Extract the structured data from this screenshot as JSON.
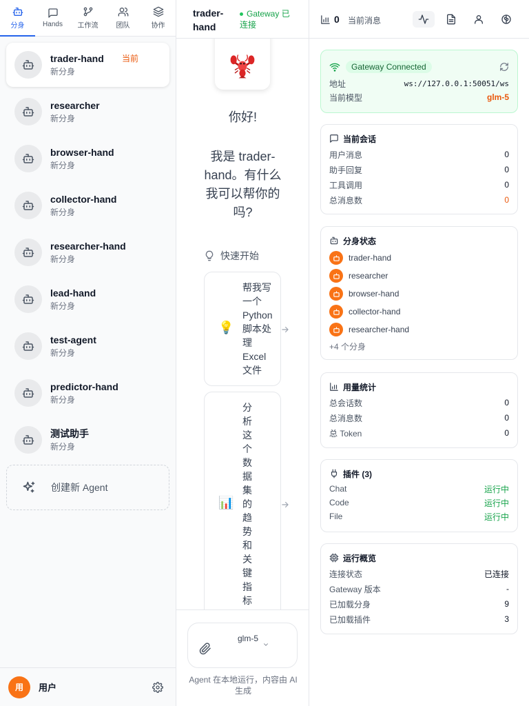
{
  "nav_tabs": [
    {
      "label": "分身",
      "icon": "bot-icon"
    },
    {
      "label": "Hands",
      "icon": "chat-icon"
    },
    {
      "label": "工作流",
      "icon": "workflow-icon"
    },
    {
      "label": "团队",
      "icon": "team-icon"
    },
    {
      "label": "协作",
      "icon": "layers-icon"
    }
  ],
  "agents": [
    {
      "name": "trader-hand",
      "sub": "新分身",
      "badge": "当前"
    },
    {
      "name": "researcher",
      "sub": "新分身"
    },
    {
      "name": "browser-hand",
      "sub": "新分身"
    },
    {
      "name": "collector-hand",
      "sub": "新分身"
    },
    {
      "name": "researcher-hand",
      "sub": "新分身"
    },
    {
      "name": "lead-hand",
      "sub": "新分身"
    },
    {
      "name": "test-agent",
      "sub": "新分身"
    },
    {
      "name": "predictor-hand",
      "sub": "新分身"
    },
    {
      "name": "测试助手",
      "sub": "新分身"
    }
  ],
  "create_agent_label": "创建新 Agent",
  "user": {
    "avatar_text": "用",
    "name": "用户"
  },
  "chat": {
    "title": "trader-hand",
    "status": "Gateway 已连接",
    "greeting": "你好!",
    "intro": "我是 trader-hand。有什么我可以帮你的吗?",
    "quick_start_label": "快速开始",
    "suggestions": [
      {
        "emoji": "💡",
        "text": "帮我写一个Python脚本处理Excel文件"
      },
      {
        "emoji": "📊",
        "text": "分析这个数据集的趋势和关键指标"
      }
    ],
    "model": "glm-5",
    "footnote": "Agent 在本地运行，内容由 AI 生成"
  },
  "right_header": {
    "count": "0",
    "label": "当前消息"
  },
  "gateway": {
    "badge": "Gateway Connected",
    "address_label": "地址",
    "address": "ws://127.0.0.1:50051/ws",
    "model_label": "当前模型",
    "model": "glm-5"
  },
  "session": {
    "title": "当前会话",
    "rows": [
      {
        "label": "用户消息",
        "value": "0"
      },
      {
        "label": "助手回复",
        "value": "0"
      },
      {
        "label": "工具调用",
        "value": "0"
      },
      {
        "label": "总消息数",
        "value": "0"
      }
    ]
  },
  "hand_status": {
    "title": "分身状态",
    "items": [
      "trader-hand",
      "researcher",
      "browser-hand",
      "collector-hand",
      "researcher-hand"
    ],
    "more": "+4 个分身"
  },
  "usage": {
    "title": "用量统计",
    "rows": [
      {
        "label": "总会话数",
        "value": "0"
      },
      {
        "label": "总消息数",
        "value": "0"
      },
      {
        "label": "总 Token",
        "value": "0"
      }
    ]
  },
  "plugins": {
    "title": "插件 (3)",
    "rows": [
      {
        "label": "Chat",
        "value": "运行中"
      },
      {
        "label": "Code",
        "value": "运行中"
      },
      {
        "label": "File",
        "value": "运行中"
      }
    ]
  },
  "overview": {
    "title": "运行概览",
    "rows": [
      {
        "label": "连接状态",
        "value": "已连接"
      },
      {
        "label": "Gateway 版本",
        "value": "-"
      },
      {
        "label": "已加载分身",
        "value": "9"
      },
      {
        "label": "已加载插件",
        "value": "3"
      }
    ]
  },
  "colors": {
    "accent": "#2563eb",
    "brand_orange": "#f97316",
    "success": "#16a34a"
  }
}
